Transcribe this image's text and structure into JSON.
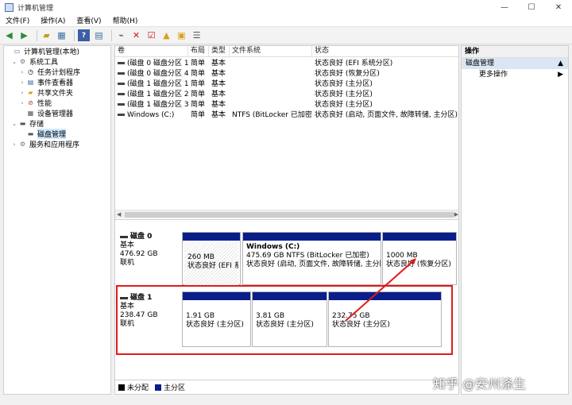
{
  "window": {
    "title": "计算机管理",
    "minimize": "—",
    "maximize": "☐",
    "close": "✕"
  },
  "menu": [
    "文件(F)",
    "操作(A)",
    "查看(V)",
    "帮助(H)"
  ],
  "tree": {
    "root": "计算机管理(本地)",
    "system_tools": "系统工具",
    "task_scheduler": "任务计划程序",
    "event_viewer": "事件查看器",
    "shared_folders": "共享文件夹",
    "performance": "性能",
    "device_manager": "设备管理器",
    "storage": "存储",
    "disk_management": "磁盘管理",
    "services": "服务和应用程序"
  },
  "volumes": {
    "headers": [
      "卷",
      "布局",
      "类型",
      "文件系统",
      "状态"
    ],
    "rows": [
      [
        "(磁盘 0 磁盘分区 1)",
        "简单",
        "基本",
        "",
        "状态良好 (EFI 系统分区)"
      ],
      [
        "(磁盘 0 磁盘分区 4)",
        "简单",
        "基本",
        "",
        "状态良好 (恢复分区)"
      ],
      [
        "(磁盘 1 磁盘分区 1)",
        "简单",
        "基本",
        "",
        "状态良好 (主分区)"
      ],
      [
        "(磁盘 1 磁盘分区 2)",
        "简单",
        "基本",
        "",
        "状态良好 (主分区)"
      ],
      [
        "(磁盘 1 磁盘分区 3)",
        "简单",
        "基本",
        "",
        "状态良好 (主分区)"
      ],
      [
        "Windows (C:)",
        "简单",
        "基本",
        "NTFS (BitLocker 已加密)",
        "状态良好 (启动, 页面文件, 故障转储, 主分区)"
      ]
    ]
  },
  "disk0": {
    "name": "磁盘 0",
    "type": "基本",
    "size": "476.92 GB",
    "status": "联机",
    "partitions": [
      {
        "title": "",
        "size": "260 MB",
        "status": "状态良好 (EFI 系统"
      },
      {
        "title": "Windows (C:)",
        "size": "475.69 GB NTFS (BitLocker 已加密)",
        "status": "状态良好 (启动, 页面文件, 故障转储, 主分区"
      },
      {
        "title": "",
        "size": "1000 MB",
        "status": "状态良好 (恢复分区)"
      }
    ]
  },
  "disk1": {
    "name": "磁盘 1",
    "type": "基本",
    "size": "238.47 GB",
    "status": "联机",
    "partitions": [
      {
        "size": "1.91 GB",
        "status": "状态良好 (主分区)"
      },
      {
        "size": "3.81 GB",
        "status": "状态良好 (主分区)"
      },
      {
        "size": "232.75 GB",
        "status": "状态良好 (主分区)"
      }
    ]
  },
  "legend": {
    "unallocated": "未分配",
    "primary": "主分区"
  },
  "actions": {
    "header": "操作",
    "selected": "磁盘管理",
    "more": "更多操作"
  },
  "watermark": "知乎 @安州涤生",
  "colors": {
    "partition_bar": "#0a1e8a",
    "annotation": "#e01b1b"
  }
}
